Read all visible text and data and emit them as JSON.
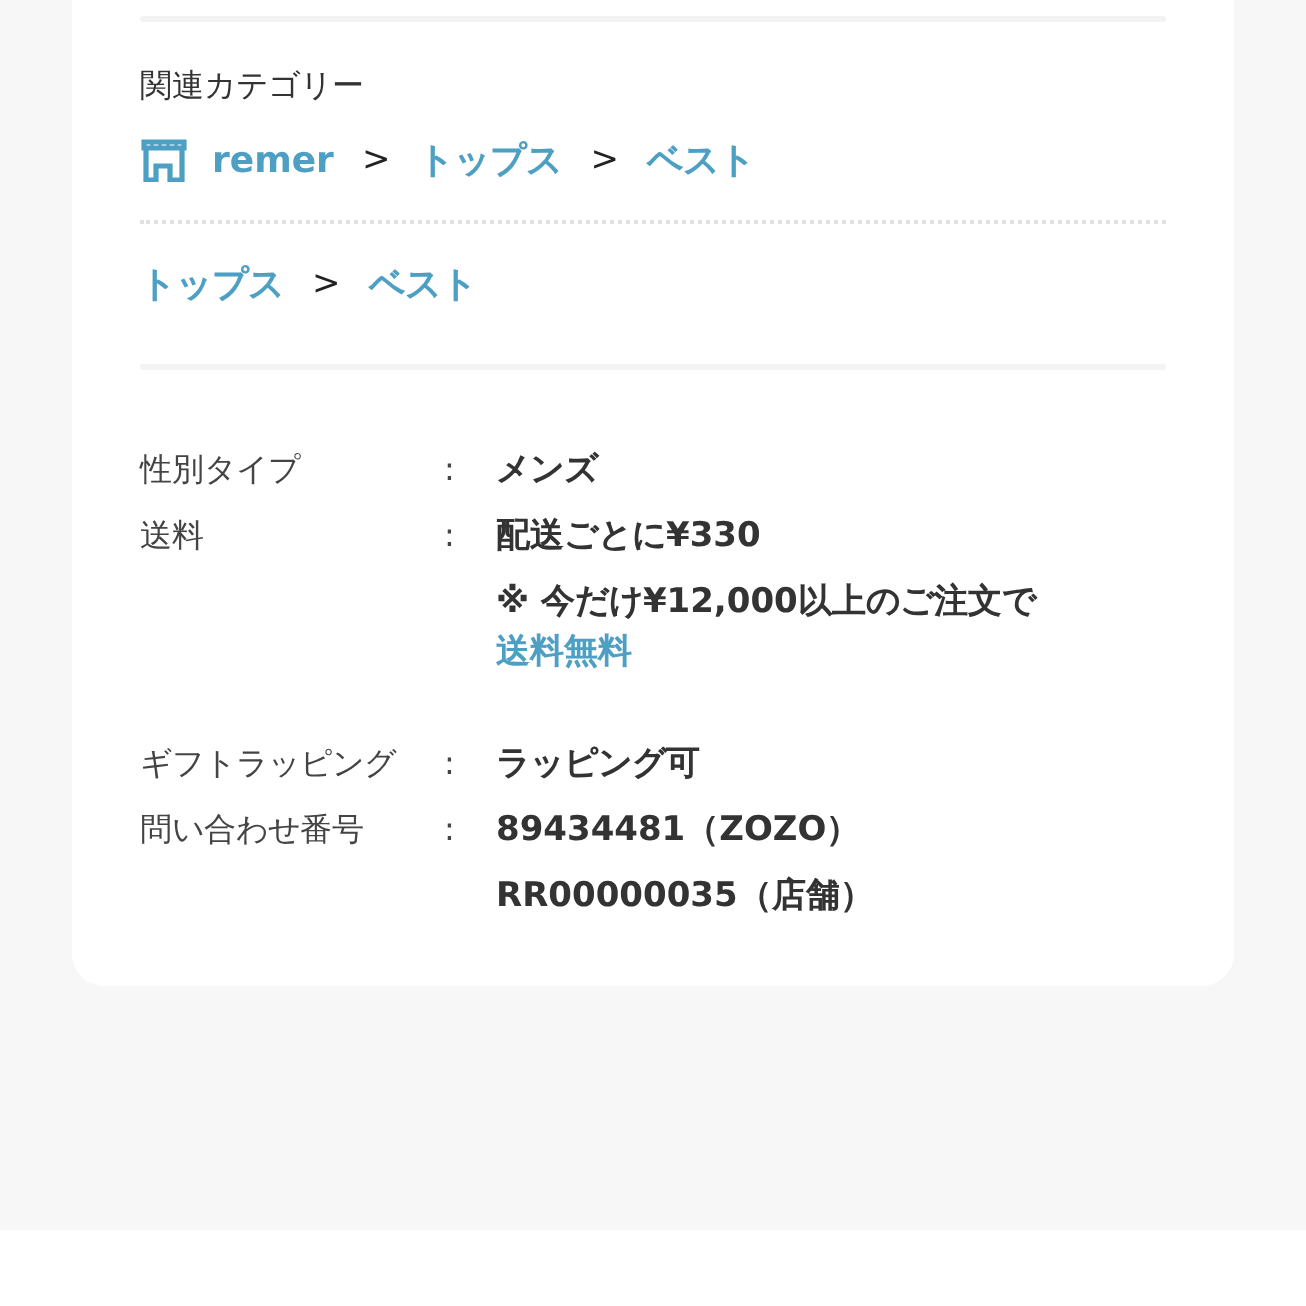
{
  "related_categories": {
    "title": "関連カテゴリー",
    "paths": [
      {
        "items": [
          {
            "kind": "shop",
            "text": "remer"
          },
          {
            "kind": "separator",
            "text": ">"
          },
          {
            "kind": "link",
            "text": "トップス"
          },
          {
            "kind": "separator",
            "text": ">"
          },
          {
            "kind": "link",
            "text": "ベスト"
          }
        ]
      },
      {
        "items": [
          {
            "kind": "link",
            "text": "トップス"
          },
          {
            "kind": "separator",
            "text": ">"
          },
          {
            "kind": "link",
            "text": "ベスト"
          }
        ]
      }
    ]
  },
  "details": [
    {
      "label": "性別タイプ",
      "colon": ":",
      "values": [
        {
          "kind": "text",
          "text": "メンズ"
        }
      ]
    },
    {
      "label": "送料",
      "colon": ":",
      "values": [
        {
          "kind": "text",
          "text": "配送ごとに¥330"
        },
        {
          "kind": "note",
          "text": "※ 今だけ¥12,000以上のご注文で",
          "link": "送料無料"
        }
      ]
    },
    {
      "label": "ギフトラッピング",
      "colon": ":",
      "values": [
        {
          "kind": "text",
          "text": "ラッピング可"
        }
      ]
    },
    {
      "label": "問い合わせ番号",
      "colon": ":",
      "values": [
        {
          "kind": "text",
          "text": "89434481（ZOZO）"
        },
        {
          "kind": "text",
          "text": "RR00000035（店舗）"
        }
      ]
    }
  ]
}
